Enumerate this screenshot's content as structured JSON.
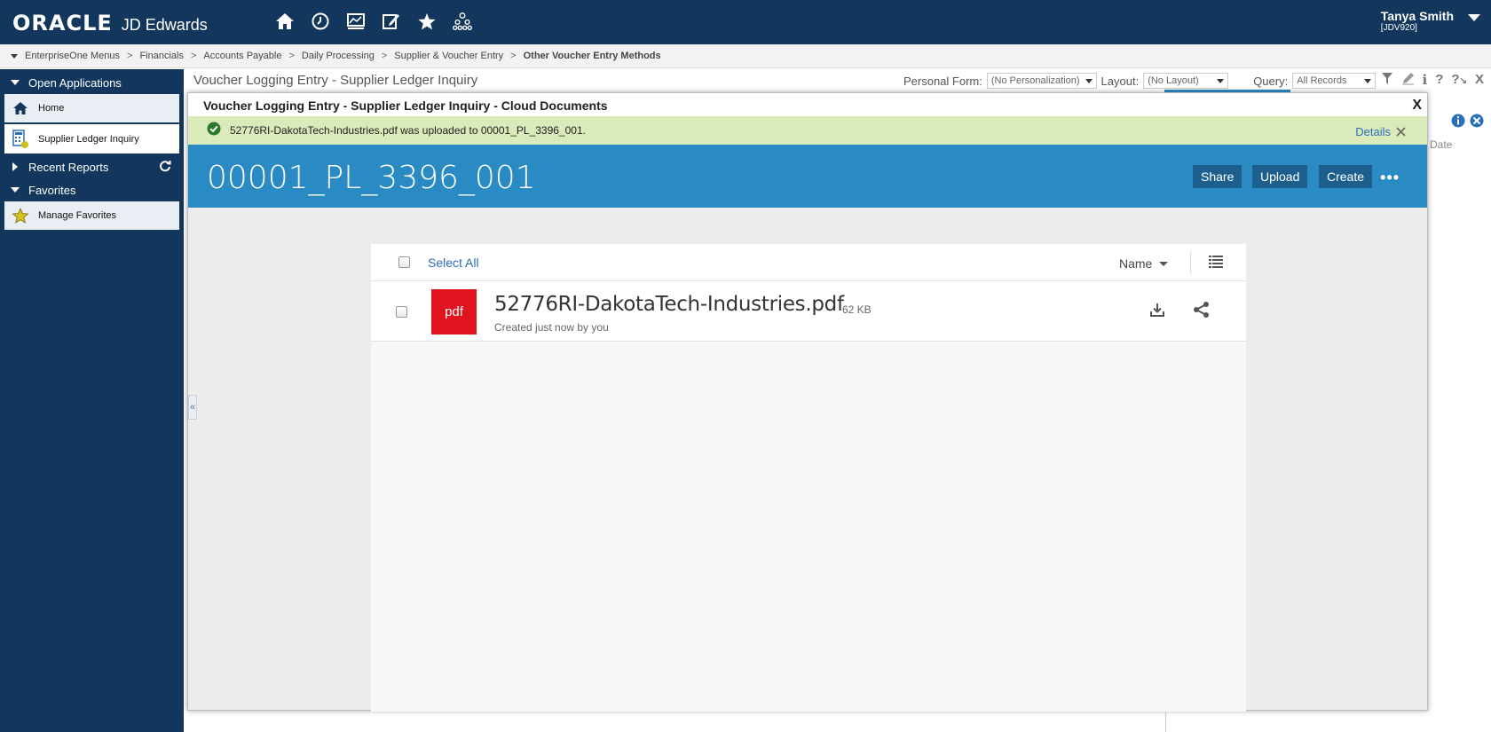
{
  "header": {
    "logo_oracle": "ORACLE",
    "logo_product": "JD Edwards",
    "user_name": "Tanya Smith",
    "user_env": "[JDV920]"
  },
  "breadcrumb": [
    "EnterpriseOne Menus",
    "Financials",
    "Accounts Payable",
    "Daily Processing",
    "Supplier & Voucher Entry",
    "Other Voucher Entry Methods"
  ],
  "sidebar": {
    "open_applications": "Open Applications",
    "items": [
      {
        "label": "Home",
        "icon": "home-icon"
      },
      {
        "label": "Supplier Ledger Inquiry",
        "icon": "calculator-icon"
      }
    ],
    "recent_reports": "Recent Reports",
    "favorites": "Favorites",
    "manage_favorites": "Manage Favorites"
  },
  "app": {
    "title": "Voucher Logging Entry - Supplier Ledger Inquiry",
    "personal_form_label": "Personal Form:",
    "personal_form_value": "(No Personalization)",
    "layout_label": "Layout:",
    "layout_value": "(No Layout)",
    "query_label": "Query:",
    "query_value": "All Records",
    "bg_date_label": "Date"
  },
  "dialog": {
    "title": "Voucher Logging Entry - Supplier Ledger Inquiry - Cloud Documents",
    "close": "X",
    "notification": "52776RI-DakotaTech-Industries.pdf was uploaded to 00001_PL_3396_001.",
    "details": "Details",
    "folder_name": "00001_PL_3396_001",
    "buttons": {
      "share": "Share",
      "upload": "Upload",
      "create": "Create",
      "more": "•••"
    },
    "select_all": "Select All",
    "sort_label": "Name",
    "files": [
      {
        "thumb": "pdf",
        "name": "52776RI-DakotaTech-Industries.pdf",
        "size": "62 KB",
        "meta": "Created just now by you"
      }
    ]
  },
  "colors": {
    "header_bg": "#12365c",
    "dialog_header_bg": "#2a8ac3",
    "notification_bg": "#dbeaba",
    "pdf_red": "#e0141e",
    "link_blue": "#2a6fbb"
  }
}
